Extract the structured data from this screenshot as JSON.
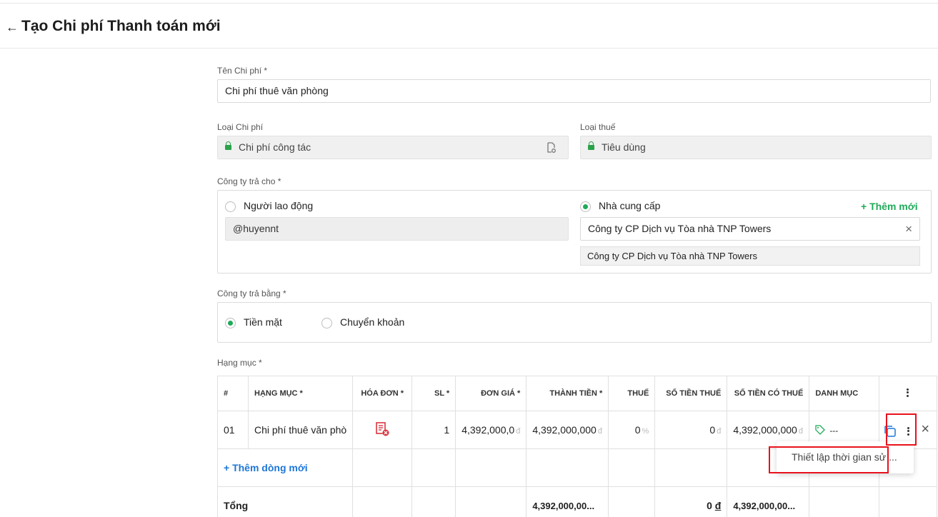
{
  "header": {
    "back_icon": "←",
    "title": "Tạo Chi phí Thanh toán mới"
  },
  "expense_name": {
    "label": "Tên Chi phí *",
    "value": "Chi phí thuê văn phòng"
  },
  "expense_type": {
    "label": "Loại Chi phí",
    "value": "Chi phí công tác"
  },
  "tax_type": {
    "label": "Loại thuế",
    "value": "Tiêu dùng"
  },
  "pay_to": {
    "label": "Công ty trả cho *",
    "employee_label": "Người lao động",
    "employee_value": "@huyennt",
    "supplier_label": "Nhà cung cấp",
    "add_new": "+ Thêm mới",
    "supplier_value": "Công ty CP Dịch vụ Tòa nhà TNP Towers",
    "supplier_suggestion": "Công ty CP Dịch vụ Tòa nhà TNP Towers",
    "selected": "supplier"
  },
  "pay_by": {
    "label": "Công ty trả bằng *",
    "cash": "Tiền mặt",
    "transfer": "Chuyển khoản",
    "selected": "cash"
  },
  "items": {
    "label": "Hạng mục *",
    "columns": [
      "#",
      "HẠNG MỤC *",
      "HÓA ĐƠN *",
      "SL *",
      "ĐƠN GIÁ *",
      "THÀNH TIỀN *",
      "THUẾ",
      "SỐ TIỀN THUẾ",
      "SỐ TIỀN CÓ THUẾ",
      "DANH MỤC"
    ],
    "row": {
      "index": "01",
      "name": "Chi phí thuê văn phò",
      "qty": "1",
      "unit_price": "4,392,000,0",
      "unit_price_cur": "đ",
      "total": "4,392,000,000",
      "total_cur": "đ",
      "tax": "0",
      "tax_unit": "%",
      "tax_amount": "0",
      "tax_amount_cur": "đ",
      "with_tax": "4,392,000,000",
      "with_tax_cur": "đ",
      "category": "---"
    },
    "add_row": "+ Thêm dòng mới",
    "sum": {
      "label": "Tổng",
      "total": "4,392,000,00...",
      "tax_amount": "0",
      "tax_cur": "đ",
      "with_tax": "4,392,000,00..."
    }
  },
  "context_menu": {
    "item": "Thiết lập thời gian sử ..."
  },
  "colors": {
    "accent_green": "#1faa59",
    "link_blue": "#1e76d6",
    "highlight_red": "#e8121c",
    "invoice_red": "#d9363e"
  }
}
